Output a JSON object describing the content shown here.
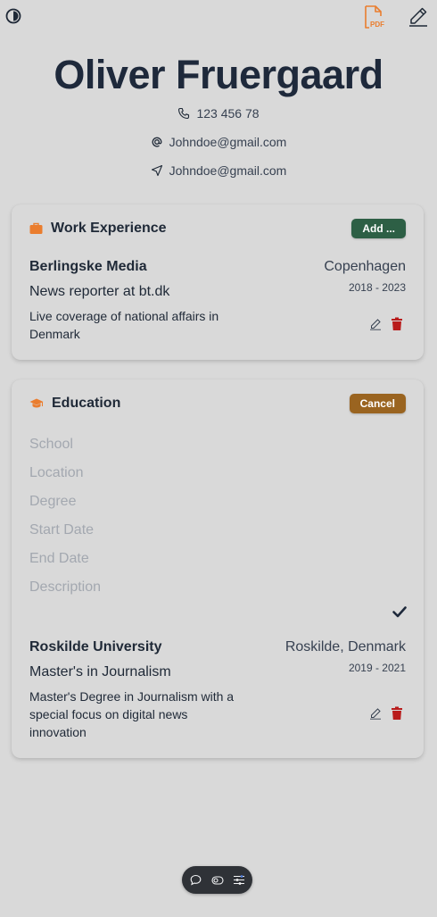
{
  "header": {
    "theme_toggle_icon": "contrast-icon",
    "pdf_icon": "pdf-file-icon",
    "pdf_label": "PDF",
    "edit_icon": "pencil-icon"
  },
  "profile": {
    "name": "Oliver Fruergaard",
    "phone": "123 456 78",
    "email": "Johndoe@gmail.com",
    "address": "Johndoe@gmail.com"
  },
  "work": {
    "title": "Work Experience",
    "add_label": "Add ...",
    "entries": [
      {
        "org": "Berlingske Media",
        "location": "Copenhagen",
        "role": "News reporter at bt.dk",
        "dates": "2018 - 2023",
        "description": "Live coverage of national affairs in Denmark"
      }
    ]
  },
  "education": {
    "title": "Education",
    "cancel_label": "Cancel",
    "form": {
      "school_placeholder": "School",
      "location_placeholder": "Location",
      "degree_placeholder": "Degree",
      "start_placeholder": "Start Date",
      "end_placeholder": "End Date",
      "description_placeholder": "Description"
    },
    "entries": [
      {
        "org": "Roskilde University",
        "location": "Roskilde, Denmark",
        "role": "Master's in Journalism",
        "dates": "2019 - 2021",
        "description": "Master's Degree in Journalism with a special focus on digital news innovation"
      }
    ]
  },
  "colors": {
    "accent_orange": "#ea7d2e",
    "add_button": "#2d5f45",
    "cancel_button": "#9a6420",
    "delete_red": "#b91c1c"
  },
  "bottom_toolbar": {
    "icons": [
      "chat-bubble-icon",
      "toggle-icon",
      "sliders-icon"
    ]
  }
}
